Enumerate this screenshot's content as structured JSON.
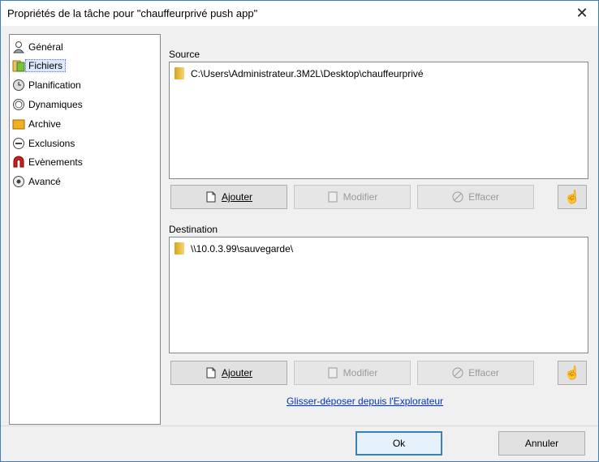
{
  "window": {
    "title": "Propriétés de la tâche pour \"chauffeurprivé push app\"",
    "close_glyph": "✕"
  },
  "sidebar": {
    "items": [
      {
        "label": "Général",
        "icon": "user-icon"
      },
      {
        "label": "Fichiers",
        "icon": "files-icon",
        "selected": true
      },
      {
        "label": "Planification",
        "icon": "clock-icon"
      },
      {
        "label": "Dynamiques",
        "icon": "sync-icon"
      },
      {
        "label": "Archive",
        "icon": "archive-icon"
      },
      {
        "label": "Exclusions",
        "icon": "minus-circle-icon"
      },
      {
        "label": "Evènements",
        "icon": "magnet-icon"
      },
      {
        "label": "Avancé",
        "icon": "gear-icon"
      }
    ]
  },
  "source": {
    "label": "Source",
    "path": "C:\\Users\\Administrateur.3M2L\\Desktop\\chauffeurprivé",
    "buttons": {
      "add": "Ajouter",
      "edit": "Modifier",
      "delete": "Effacer"
    }
  },
  "destination": {
    "label": "Destination",
    "path": "\\\\10.0.3.99\\sauvegarde\\",
    "buttons": {
      "add": "Ajouter",
      "edit": "Modifier",
      "delete": "Effacer"
    }
  },
  "drag_link": "Glisser-déposer depuis l'Explorateur",
  "footer": {
    "ok": "Ok",
    "cancel": "Annuler"
  }
}
